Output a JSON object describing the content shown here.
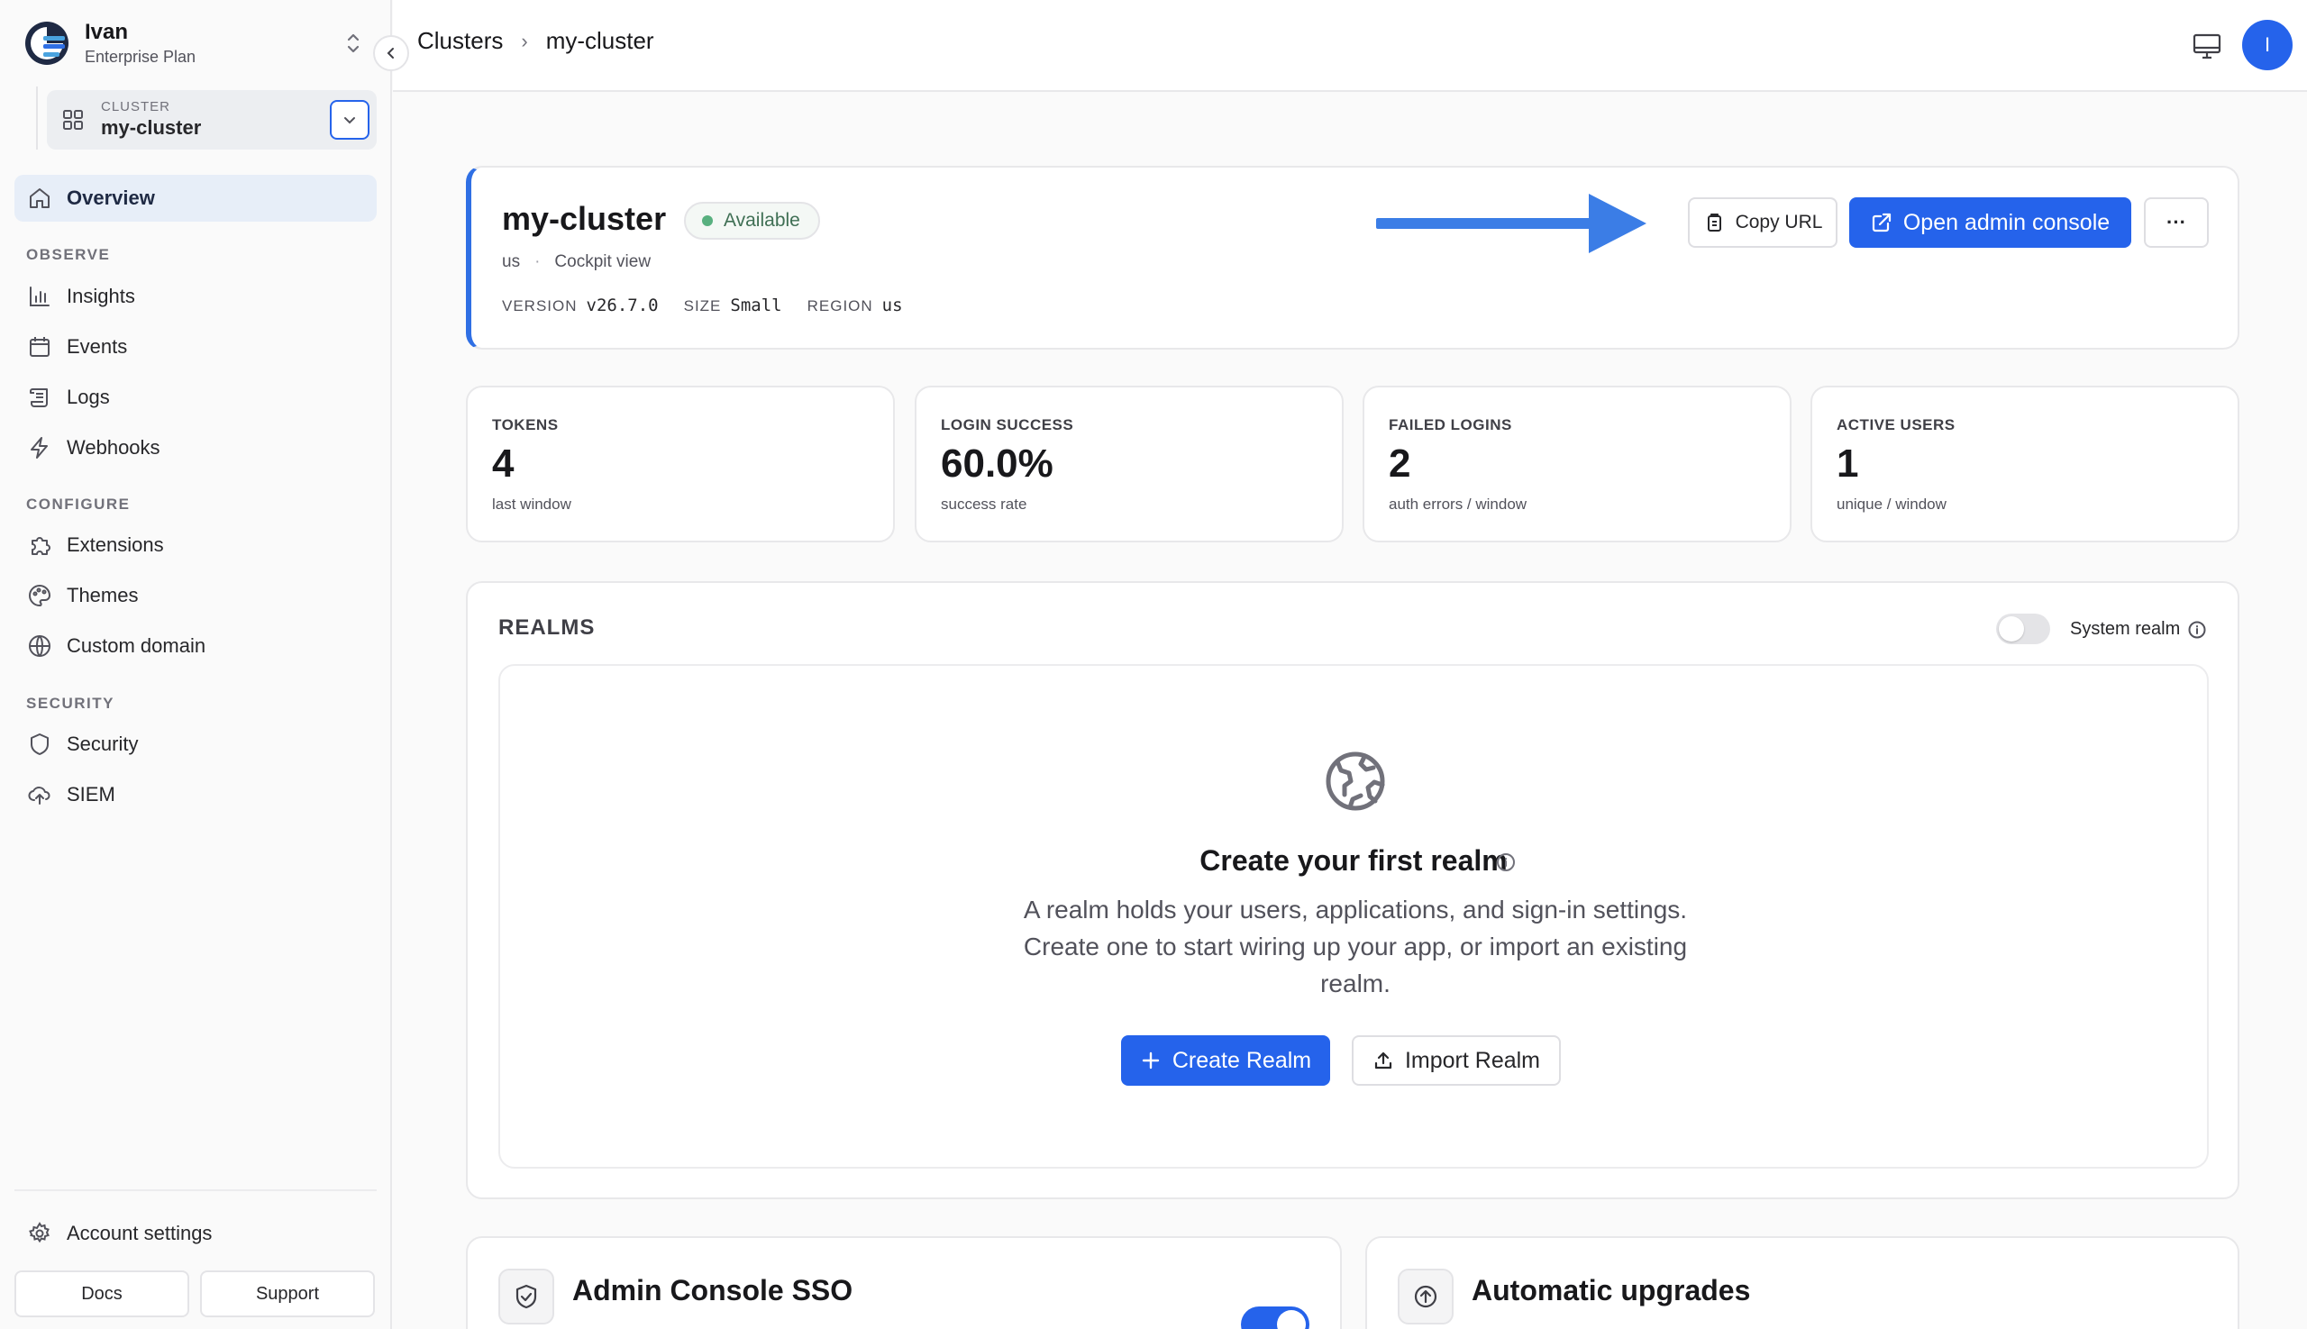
{
  "org": {
    "name": "Ivan",
    "plan": "Enterprise Plan"
  },
  "cluster_selector": {
    "label": "CLUSTER",
    "value": "my-cluster"
  },
  "nav": {
    "overview": "Overview",
    "observe_title": "OBSERVE",
    "observe": [
      "Insights",
      "Events",
      "Logs",
      "Webhooks"
    ],
    "configure_title": "CONFIGURE",
    "configure": [
      "Extensions",
      "Themes",
      "Custom domain"
    ],
    "security_title": "SECURITY",
    "security": [
      "Security",
      "SIEM"
    ],
    "account": "Account settings",
    "docs": "Docs",
    "support": "Support"
  },
  "breadcrumb": {
    "root": "Clusters",
    "current": "my-cluster"
  },
  "user": {
    "initial": "I"
  },
  "cluster": {
    "name": "my-cluster",
    "status": "Available",
    "region_short": "us",
    "view_link": "Cockpit view",
    "meta": {
      "version_label": "VERSION",
      "version": "v26.7.0",
      "size_label": "SIZE",
      "size": "Small",
      "region_label": "REGION",
      "region": "us"
    },
    "copy_url": "Copy URL",
    "open_console": "Open admin console",
    "more": "···"
  },
  "stats": [
    {
      "label": "TOKENS",
      "value": "4",
      "sub": "last window"
    },
    {
      "label": "LOGIN SUCCESS",
      "value": "60.0%",
      "sub": "success rate"
    },
    {
      "label": "FAILED LOGINS",
      "value": "2",
      "sub": "auth errors / window"
    },
    {
      "label": "ACTIVE USERS",
      "value": "1",
      "sub": "unique / window"
    }
  ],
  "realms": {
    "title": "REALMS",
    "system_realm_label": "System realm",
    "system_realm_on": false,
    "empty_title": "Create your first realm",
    "empty_desc": "A realm holds your users, applications, and sign-in settings. Create one to start wiring up your app, or import an existing realm.",
    "create": "Create Realm",
    "import": "Import Realm"
  },
  "features": [
    {
      "title": "Admin Console SSO",
      "enabled": true
    },
    {
      "title": "Automatic upgrades"
    }
  ],
  "colors": {
    "accent": "#2563eb",
    "status_ok": "#58b07f",
    "hero_border": "#2f6fe4"
  }
}
